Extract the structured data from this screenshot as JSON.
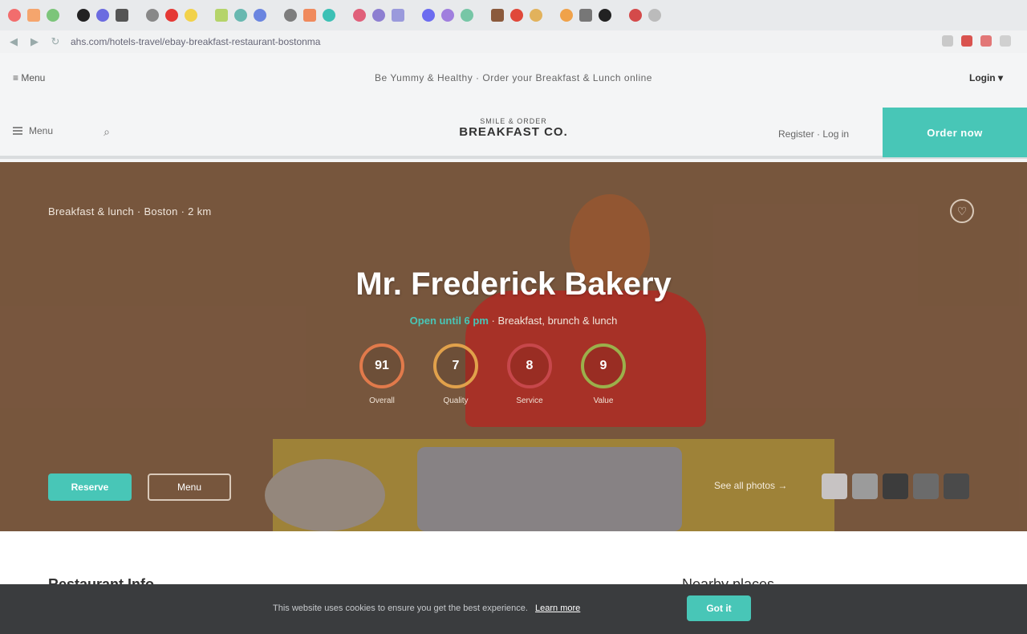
{
  "browser": {
    "tab_favicons": [
      "#f26d6d",
      "#f5a56d",
      "#7cc57a",
      "#222222",
      "#6b6be0",
      "#555555",
      "#888888",
      "#e53935",
      "#f2d24a",
      "#b5d46a",
      "#68b8b0",
      "#6a85e0",
      "#7d7d7d",
      "#f08a5d",
      "#3cc0b5",
      "#e0607a",
      "#8d7fd1",
      "#9a9adc",
      "#6c6cf0",
      "#a07fde",
      "#77c6a6",
      "#8b5a3c",
      "#e0483a",
      "#e2b25c",
      "#f0a24a",
      "#777777",
      "#222222",
      "#d44a4a",
      "#bbbbbb"
    ],
    "url": "ahs.com/hotels-travel/ebay-breakfast-restaurant-bostonma",
    "extension_colors": [
      "#c9c9c9",
      "#d9534f",
      "#e27777",
      "#d0d0d0"
    ]
  },
  "topstrip": {
    "left": "≡ Menu",
    "center": "Be Yummy & Healthy · Order your Breakfast & Lunch online",
    "right": "Login ▾"
  },
  "header": {
    "menu_label": "Menu",
    "logo_line1": "SMILE & ORDER",
    "logo_line2": "BREAKFAST CO.",
    "login_label": "Register · Log in",
    "cta_label": "Order now"
  },
  "hero": {
    "breadcrumb": "Breakfast & lunch · Boston · 2 km",
    "title": "Mr. Frederick Bakery",
    "subtitle_accent": "Open until 6 pm",
    "subtitle_rest": "· Breakfast, brunch & lunch",
    "metrics": [
      {
        "value": "91",
        "label": "Overall",
        "color": "#e17a4b"
      },
      {
        "value": "7",
        "label": "Quality",
        "color": "#e1a14b"
      },
      {
        "value": "8",
        "label": "Service",
        "color": "#c7474b"
      },
      {
        "value": "9",
        "label": "Value",
        "color": "#9bb04b"
      }
    ],
    "primary_button": "Reserve",
    "secondary_button": "Menu",
    "gallery_label": "See all photos →",
    "thumb_colors": [
      "#c7c3c3",
      "#9b9b9b",
      "#3c3c3c",
      "#6b6b6b",
      "#4a4a4a"
    ]
  },
  "content": {
    "title": "Restaurant Info",
    "right_text": "Nearby places"
  },
  "cookie": {
    "text": "This website uses cookies to ensure you get the best experience.",
    "link": "Learn more",
    "button": "Got it"
  }
}
